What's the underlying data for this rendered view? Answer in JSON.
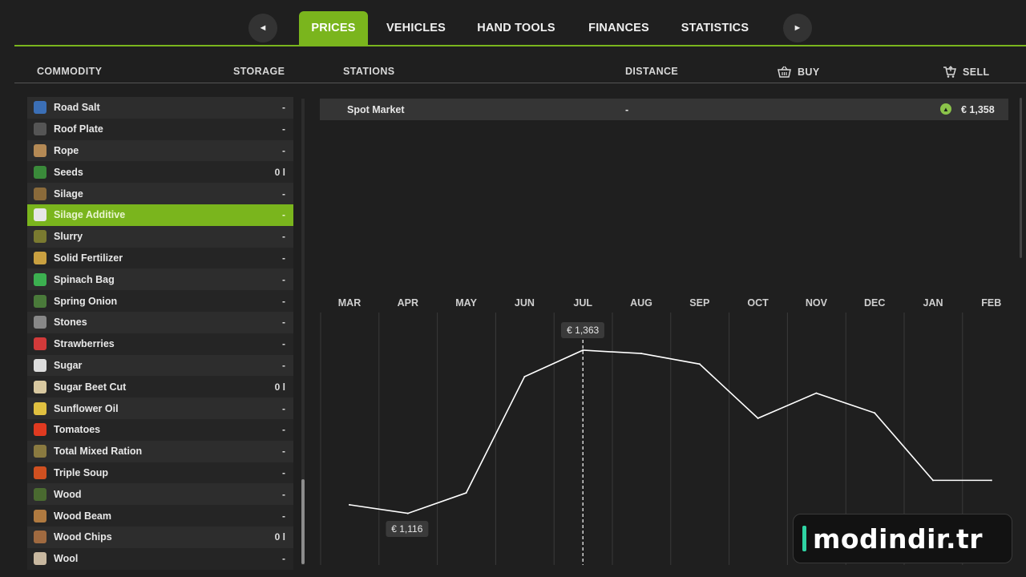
{
  "nav": {
    "prev_icon": "arrow-left",
    "next_icon": "arrow-right",
    "tabs": [
      {
        "label": "PRICES",
        "active": true
      },
      {
        "label": "VEHICLES",
        "active": false
      },
      {
        "label": "HAND TOOLS",
        "active": false
      },
      {
        "label": "FINANCES",
        "active": false
      },
      {
        "label": "STATISTICS",
        "active": false
      }
    ]
  },
  "columns": {
    "commodity": "COMMODITY",
    "storage": "STORAGE",
    "stations": "STATIONS",
    "distance": "DISTANCE",
    "buy": "BUY",
    "sell": "SELL",
    "buy_icon": "basket-icon",
    "sell_icon": "cart-icon"
  },
  "commodities": [
    {
      "name": "Road Salt",
      "storage": "-",
      "icon": "salt",
      "color": "#3b6fb6"
    },
    {
      "name": "Roof Plate",
      "storage": "-",
      "icon": "roof-plate",
      "color": "#555"
    },
    {
      "name": "Rope",
      "storage": "-",
      "icon": "rope",
      "color": "#b58a55"
    },
    {
      "name": "Seeds",
      "storage": "0 l",
      "icon": "seeds",
      "color": "#3a8a3a"
    },
    {
      "name": "Silage",
      "storage": "-",
      "icon": "silage",
      "color": "#8a6a3a"
    },
    {
      "name": "Silage Additive",
      "storage": "-",
      "icon": "silage-additive",
      "color": "#e6e6e6",
      "selected": true
    },
    {
      "name": "Slurry",
      "storage": "-",
      "icon": "slurry",
      "color": "#7a7a30"
    },
    {
      "name": "Solid Fertilizer",
      "storage": "-",
      "icon": "fertilizer",
      "color": "#c9a040"
    },
    {
      "name": "Spinach Bag",
      "storage": "-",
      "icon": "spinach",
      "color": "#3cb050"
    },
    {
      "name": "Spring Onion",
      "storage": "-",
      "icon": "onion",
      "color": "#4a7a3a"
    },
    {
      "name": "Stones",
      "storage": "-",
      "icon": "stones",
      "color": "#888"
    },
    {
      "name": "Strawberries",
      "storage": "-",
      "icon": "strawberry",
      "color": "#d23a3a"
    },
    {
      "name": "Sugar",
      "storage": "-",
      "icon": "sugar",
      "color": "#ddd"
    },
    {
      "name": "Sugar Beet Cut",
      "storage": "0 l",
      "icon": "sugar-beet",
      "color": "#d8c8a0"
    },
    {
      "name": "Sunflower Oil",
      "storage": "-",
      "icon": "oil",
      "color": "#e0c040"
    },
    {
      "name": "Tomatoes",
      "storage": "-",
      "icon": "tomato",
      "color": "#e03a20"
    },
    {
      "name": "Total Mixed Ration",
      "storage": "-",
      "icon": "tmr",
      "color": "#8a7a40"
    },
    {
      "name": "Triple Soup",
      "storage": "-",
      "icon": "soup",
      "color": "#d05020"
    },
    {
      "name": "Wood",
      "storage": "-",
      "icon": "wood",
      "color": "#4a6a30"
    },
    {
      "name": "Wood Beam",
      "storage": "-",
      "icon": "wood-beam",
      "color": "#b07a40"
    },
    {
      "name": "Wood Chips",
      "storage": "0 l",
      "icon": "wood-chips",
      "color": "#a06a40"
    },
    {
      "name": "Wool",
      "storage": "-",
      "icon": "wool",
      "color": "#c8b8a0"
    }
  ],
  "stations": [
    {
      "name": "Spot Market",
      "distance": "-",
      "buy": "",
      "sell": "€ 1,358",
      "trend": "up",
      "trend_color": "#8bc34a"
    }
  ],
  "chart_data": {
    "type": "line",
    "categories": [
      "MAR",
      "APR",
      "MAY",
      "JUN",
      "JUL",
      "AUG",
      "SEP",
      "OCT",
      "NOV",
      "DEC",
      "JAN",
      "FEB"
    ],
    "values": [
      1129,
      1116,
      1147,
      1323,
      1363,
      1358,
      1342,
      1260,
      1298,
      1268,
      1166,
      1166
    ],
    "ylim": [
      1050,
      1420
    ],
    "highlight_index": 4,
    "max_label": "€ 1,363",
    "min_label": "€ 1,116",
    "min_index": 1,
    "line_color": "#ffffff",
    "grid": true
  },
  "watermark": {
    "text": "modindir.tr",
    "accent": "#2fd3a3"
  }
}
